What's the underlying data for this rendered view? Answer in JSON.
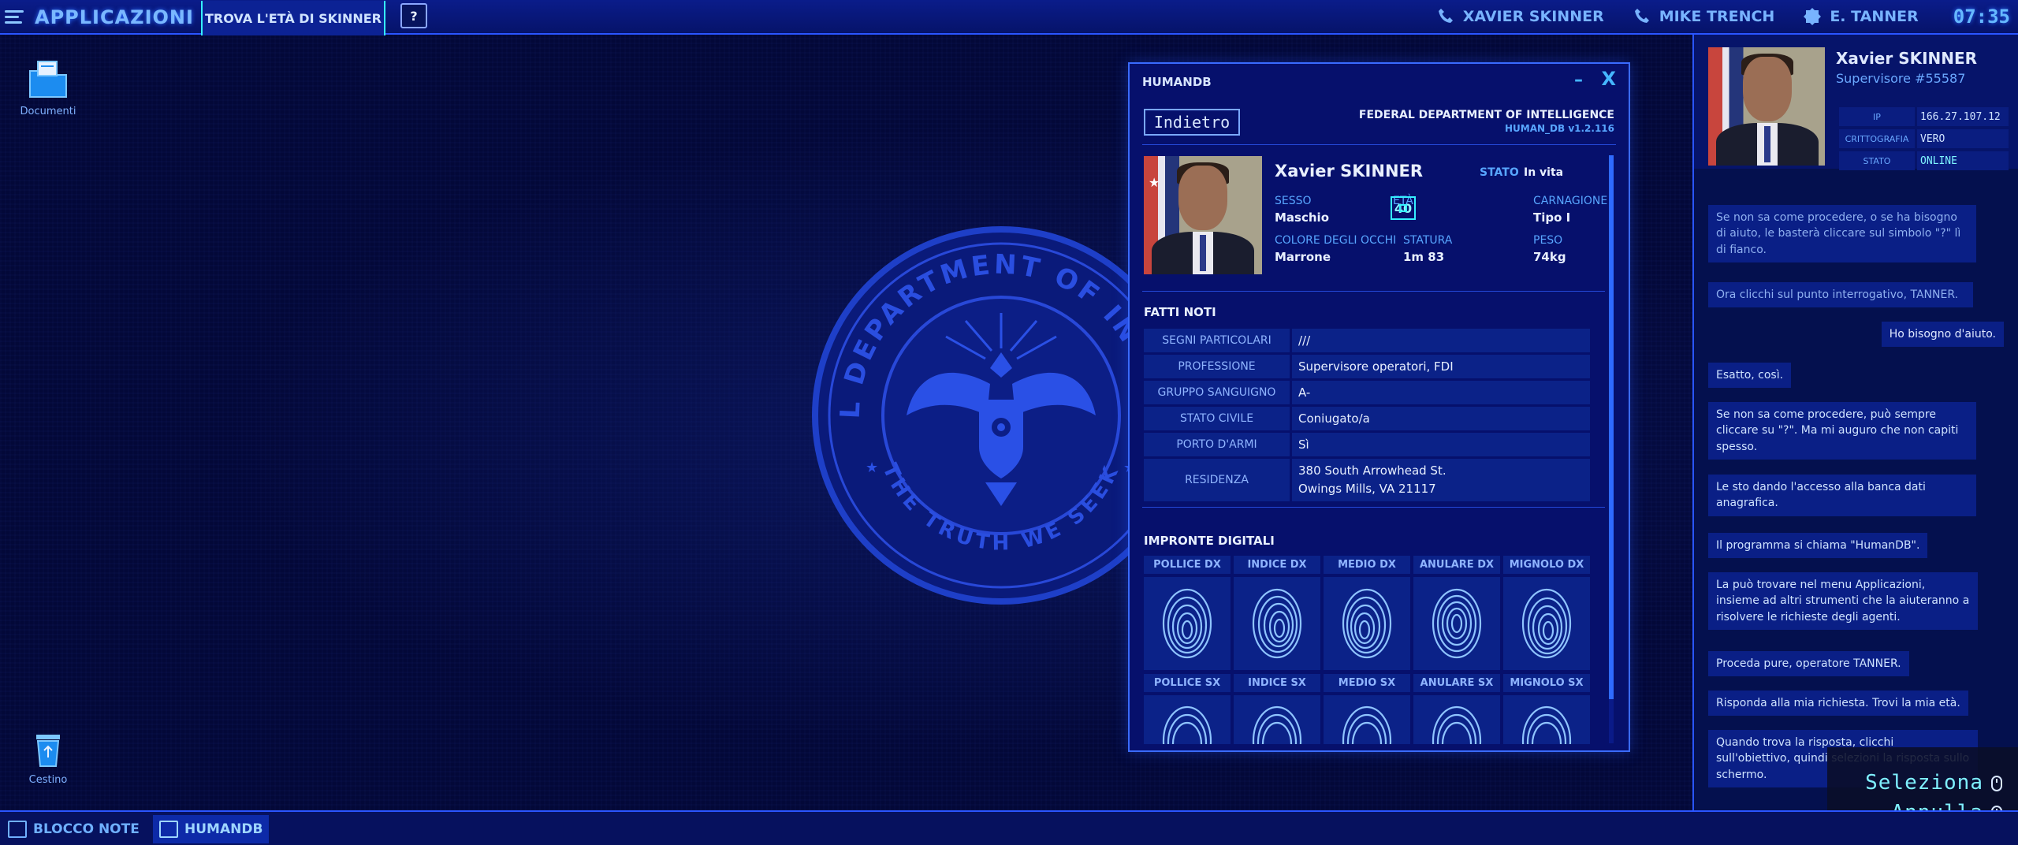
{
  "topbar": {
    "apps_label": "APPLICAZIONI",
    "task_label": "TROVA L'ETÀ DI SKINNER",
    "help_label": "?",
    "contacts": [
      "XAVIER SKINNER",
      "MIKE TRENCH",
      "E. TANNER"
    ],
    "clock": "07:35"
  },
  "desktop": {
    "icons": [
      {
        "label": "Documenti",
        "icon": "folder-icon"
      },
      {
        "label": "Cestino",
        "icon": "trash-icon"
      }
    ],
    "seal": {
      "top_text": "FEDERAL DEPARTMENT OF INTELLIGENCE",
      "bottom_text": "THE TRUTH WE SEEK"
    }
  },
  "window": {
    "title": "HUMANDB",
    "minimize": "–",
    "close": "X",
    "back_label": "Indietro",
    "agency": "FEDERAL DEPARTMENT OF INTELLIGENCE",
    "db_version": "HUMAN_DB   v1.2.116",
    "person": {
      "name": "Xavier  SKINNER",
      "stato_label": "STATO",
      "stato_value": "In vita",
      "sesso_label": "SESSO",
      "sesso_value": "Maschio",
      "eta_label": "ETÀ",
      "eta_value": "40",
      "carnagione_label": "CARNAGIONE",
      "carnagione_value": "Tipo I",
      "occhi_label": "COLORE DEGLI OCCHI",
      "occhi_value": "Marrone",
      "statura_label": "STATURA",
      "statura_value": "1m 83",
      "peso_label": "PESO",
      "peso_value": "74kg"
    },
    "facts_title": "FATTI  NOTI",
    "facts": [
      {
        "k": "SEGNI PARTICOLARI",
        "v": "///"
      },
      {
        "k": "PROFESSIONE",
        "v": "Supervisore operatori, FDI"
      },
      {
        "k": "GRUPPO SANGUIGNO",
        "v": "A-"
      },
      {
        "k": "STATO CIVILE",
        "v": "Coniugato/a"
      },
      {
        "k": "PORTO D'ARMI",
        "v": "Sì"
      },
      {
        "k": "RESIDENZA",
        "v": "380 South Arrowhead St.\nOwings Mills, VA 21117"
      }
    ],
    "prints_title": "IMPRONTE  DIGITALI",
    "prints_right": [
      "POLLICE DX",
      "INDICE DX",
      "MEDIO DX",
      "ANULARE DX",
      "MIGNOLO DX"
    ],
    "prints_left": [
      "POLLICE SX",
      "INDICE SX",
      "MEDIO SX",
      "ANULARE SX",
      "MIGNOLO SX"
    ]
  },
  "panel": {
    "name": "Xavier SKINNER",
    "role": "Supervisore #55587",
    "info": [
      {
        "k": "IP",
        "v": "166.27.107.12"
      },
      {
        "k": "CRITTOGRAFIA",
        "v": "VERO"
      },
      {
        "k": "STATO",
        "v": "ONLINE"
      }
    ],
    "messages": [
      {
        "text": "Se non sa come procedere, o se ha bisogno di aiuto, le basterà cliccare sul simbolo \"?\" lì di fianco.",
        "side": "left",
        "style": "sys"
      },
      {
        "text": "Ora clicchi sul punto interrogativo, TANNER.",
        "side": "left",
        "style": "sys"
      },
      {
        "text": "Ho bisogno d'aiuto.",
        "side": "right",
        "style": "right"
      },
      {
        "text": "Esatto, così.",
        "side": "left",
        "style": ""
      },
      {
        "text": "Se non sa come procedere, può sempre cliccare su \"?\". Ma mi auguro che non capiti spesso.",
        "side": "left",
        "style": ""
      },
      {
        "text": "Le sto dando l'accesso alla banca dati anagrafica.",
        "side": "left",
        "style": ""
      },
      {
        "text": "Il programma si chiama \"HumanDB\".",
        "side": "left",
        "style": ""
      },
      {
        "text": "La può trovare nel menu Applicazioni, insieme ad altri strumenti che la aiuteranno a risolvere le richieste degli agenti.",
        "side": "left",
        "style": ""
      },
      {
        "text": "Proceda pure, operatore TANNER.",
        "side": "left",
        "style": ""
      },
      {
        "text": "Risponda alla mia richiesta. Trovi la mia età.",
        "side": "left",
        "style": ""
      },
      {
        "text": "Quando trova la risposta, clicchi sull'obiettivo, quindi selezioni la risposta sullo schermo.",
        "side": "left",
        "style": ""
      }
    ]
  },
  "overlay": {
    "select_label": "Seleziona",
    "cancel_label": "Annulla"
  },
  "taskbar": {
    "items": [
      {
        "label": "BLOCCO NOTE",
        "active": false
      },
      {
        "label": "HUMANDB",
        "active": true
      }
    ]
  },
  "colors": {
    "accent": "#2a55ff",
    "highlight": "#35f0ff",
    "panel": "#0b2288",
    "background": "#030838"
  }
}
